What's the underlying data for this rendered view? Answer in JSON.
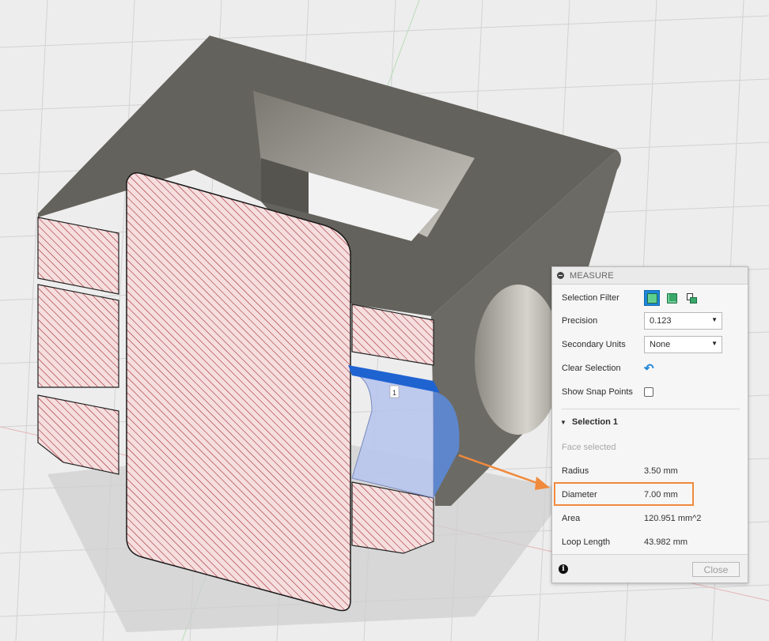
{
  "viewport": {
    "annotation_label": "1",
    "colors": {
      "background": "#ededed",
      "body_dark": "#5f5d57",
      "body_mid": "#7a7771",
      "section_fill": "#f3dcdc",
      "section_hatch": "#b0202a",
      "selected_face": "#9fb3e6",
      "selected_edge": "#1f63d1",
      "arrow": "#f08a3c"
    }
  },
  "measure_panel": {
    "title": "MEASURE",
    "selection_filter": {
      "label": "Selection Filter",
      "icons": [
        "face-select-icon",
        "body-select-icon",
        "component-select-icon"
      ]
    },
    "precision": {
      "label": "Precision",
      "value": "0.123"
    },
    "secondary_units": {
      "label": "Secondary Units",
      "value": "None"
    },
    "clear_selection": {
      "label": "Clear Selection"
    },
    "show_snap_points": {
      "label": "Show Snap Points",
      "checked": false
    },
    "selection_1": {
      "title": "Selection 1",
      "status": "Face selected",
      "radius": {
        "label": "Radius",
        "value": "3.50 mm"
      },
      "diameter": {
        "label": "Diameter",
        "value": "7.00 mm"
      },
      "area": {
        "label": "Area",
        "value": "120.951 mm^2"
      },
      "loop_length": {
        "label": "Loop Length",
        "value": "43.982 mm"
      }
    },
    "close_label": "Close",
    "highlight_color": "#f08a3c"
  }
}
